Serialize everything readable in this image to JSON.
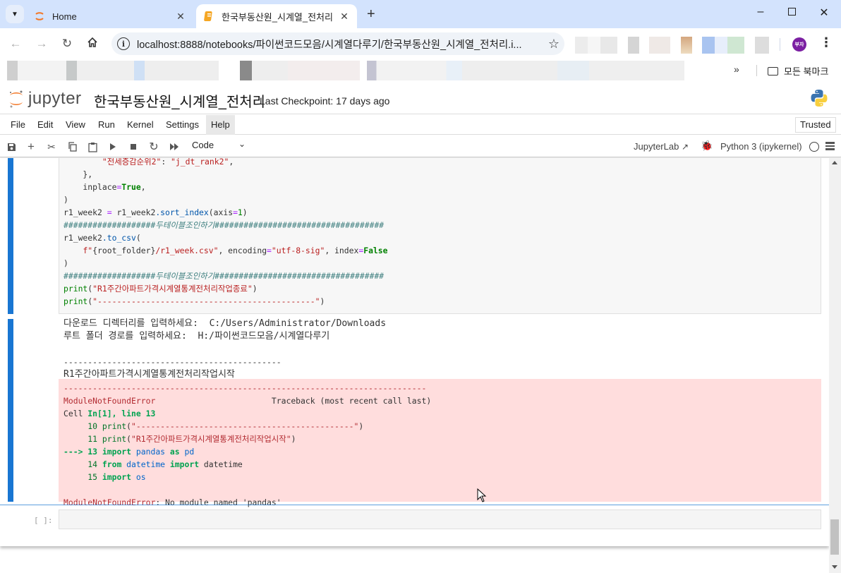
{
  "browser": {
    "tabs": [
      {
        "title": "Home",
        "icon": "jupyter-favicon",
        "active": false
      },
      {
        "title": "한국부동산원_시계열_전처리",
        "icon": "notebook-favicon",
        "active": true
      }
    ],
    "url": "localhost:8888/notebooks/파이썬코드모음/시계열다루기/한국부동산원_시계열_전처리.i...",
    "profile_label": "부자",
    "bookmarks_all_label": "모든 북마크",
    "window_controls": {
      "minimize": "–",
      "maximize": "☐",
      "close": "✕"
    }
  },
  "jupyter": {
    "logo_text": "jupyter",
    "notebook_title": "한국부동산원_시계열_전처리",
    "checkpoint": "Last Checkpoint: 17 days ago",
    "menu": [
      "File",
      "Edit",
      "View",
      "Run",
      "Kernel",
      "Settings",
      "Help"
    ],
    "trusted_label": "Trusted",
    "toolbar": {
      "cell_type": "Code",
      "jupyterlab_label": "JupyterLab",
      "kernel_label": "Python 3 (ipykernel)"
    }
  },
  "cells": {
    "code_lines": [
      [
        {
          "t": "        "
        },
        {
          "t": "\"전세증감순위2\"",
          "c": "s"
        },
        {
          "t": ": "
        },
        {
          "t": "\"j_dt_rank2\"",
          "c": "s"
        },
        {
          "t": ","
        }
      ],
      [
        {
          "t": "    },"
        }
      ],
      [
        {
          "t": "    inplace"
        },
        {
          "t": "=",
          "c": "o"
        },
        {
          "t": "True",
          "c": "k"
        },
        {
          "t": ","
        }
      ],
      [
        {
          "t": ")"
        }
      ],
      [
        {
          "t": "r1_week2 "
        },
        {
          "t": "=",
          "c": "o"
        },
        {
          "t": " r1_week2"
        },
        {
          "t": ".sort_index",
          "c": "f"
        },
        {
          "t": "(axis"
        },
        {
          "t": "=",
          "c": "o"
        },
        {
          "t": "1",
          "c": "num"
        },
        {
          "t": ")"
        }
      ],
      [
        {
          "t": "###################두테이블조인하기###################################",
          "c": "c"
        }
      ],
      [
        {
          "t": "r1_week2"
        },
        {
          "t": ".to_csv",
          "c": "f"
        },
        {
          "t": "("
        }
      ],
      [
        {
          "t": "    "
        },
        {
          "t": "f\"",
          "c": "s"
        },
        {
          "t": "{root_folder}"
        },
        {
          "t": "/r1_week.csv\"",
          "c": "s"
        },
        {
          "t": ", encoding"
        },
        {
          "t": "=",
          "c": "o"
        },
        {
          "t": "\"utf-8-sig\"",
          "c": "s"
        },
        {
          "t": ", index"
        },
        {
          "t": "=",
          "c": "o"
        },
        {
          "t": "False",
          "c": "k"
        }
      ],
      [
        {
          "t": ")"
        }
      ],
      [
        {
          "t": "###################두테이블조인하기###################################",
          "c": "c"
        }
      ],
      [
        {
          "t": "print",
          "c": "n"
        },
        {
          "t": "("
        },
        {
          "t": "\"R1주간아파트가격시계열통계전처리작업종료\"",
          "c": "s"
        },
        {
          "t": ")"
        }
      ],
      [
        {
          "t": "print",
          "c": "n"
        },
        {
          "t": "("
        },
        {
          "t": "\"---------------------------------------------\"",
          "c": "s"
        },
        {
          "t": ")"
        }
      ]
    ],
    "stdout_lines": [
      "다운로드 디렉터리를 입력하세요:  C:/Users/Administrator/Downloads",
      "루트 폴더 경로를 입력하세요:  H:/파이썬코드모음/시계열다루기",
      "",
      "---------------------------------------------",
      "R1주간아파트가격시계열통계전처리작업시작"
    ],
    "error_lines": [
      [
        {
          "t": "---------------------------------------------------------------------------",
          "c": "er"
        }
      ],
      [
        {
          "t": "ModuleNotFoundError",
          "c": "er"
        },
        {
          "t": "                        Traceback (most recent call last)"
        }
      ],
      [
        {
          "t": "Cell "
        },
        {
          "t": "In[1], line 13",
          "c": "eg"
        }
      ],
      [
        {
          "t": "     "
        },
        {
          "t": "10",
          "c": "egn"
        },
        {
          "t": " "
        },
        {
          "t": "print",
          "c": "egn"
        },
        {
          "t": "("
        },
        {
          "t": "\"---------------------------------------------\"",
          "c": "er"
        },
        {
          "t": ")"
        }
      ],
      [
        {
          "t": "     "
        },
        {
          "t": "11",
          "c": "egn"
        },
        {
          "t": " "
        },
        {
          "t": "print",
          "c": "egn"
        },
        {
          "t": "("
        },
        {
          "t": "\"R1주간아파트가격시계열통계전처리작업시작\"",
          "c": "er"
        },
        {
          "t": ")"
        }
      ],
      [
        {
          "t": "---> ",
          "c": "eg"
        },
        {
          "t": "13",
          "c": "eg"
        },
        {
          "t": " "
        },
        {
          "t": "import",
          "c": "eg"
        },
        {
          "t": " "
        },
        {
          "t": "pandas",
          "c": "eb"
        },
        {
          "t": " "
        },
        {
          "t": "as",
          "c": "eg"
        },
        {
          "t": " "
        },
        {
          "t": "pd",
          "c": "eb"
        }
      ],
      [
        {
          "t": "     "
        },
        {
          "t": "14",
          "c": "egn"
        },
        {
          "t": " "
        },
        {
          "t": "from",
          "c": "eg"
        },
        {
          "t": " "
        },
        {
          "t": "datetime",
          "c": "eb"
        },
        {
          "t": " "
        },
        {
          "t": "import",
          "c": "eg"
        },
        {
          "t": " datetime"
        }
      ],
      [
        {
          "t": "     "
        },
        {
          "t": "15",
          "c": "egn"
        },
        {
          "t": " "
        },
        {
          "t": "import",
          "c": "eg"
        },
        {
          "t": " "
        },
        {
          "t": "os",
          "c": "eb"
        }
      ],
      [
        {
          "t": ""
        }
      ],
      [
        {
          "t": "ModuleNotFoundError",
          "c": "er"
        },
        {
          "t": ": No module named 'pandas'"
        }
      ]
    ],
    "empty_prompt": "[ ]:"
  }
}
